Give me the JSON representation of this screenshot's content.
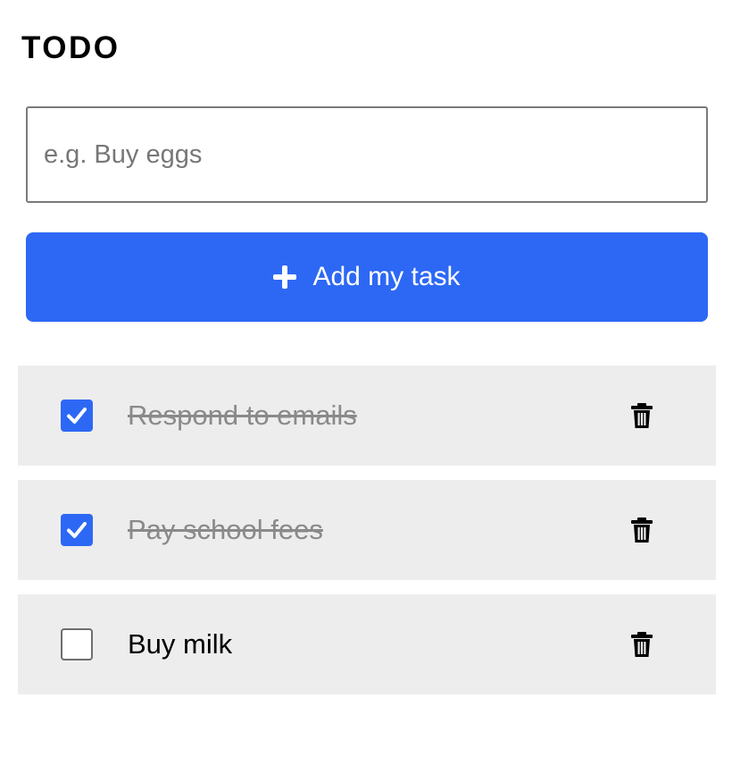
{
  "app": {
    "title": "TODO"
  },
  "new_task": {
    "placeholder": "e.g. Buy eggs",
    "value": "",
    "add_button_label": "Add my task",
    "add_button_icon": "plus-icon"
  },
  "tasks": [
    {
      "label": "Respond to emails",
      "completed": true
    },
    {
      "label": "Pay school fees",
      "completed": true
    },
    {
      "label": "Buy milk",
      "completed": false
    }
  ],
  "icons": {
    "delete": "trash-icon",
    "check": "checkmark-icon"
  },
  "colors": {
    "accent": "#2d68f5",
    "row_background": "#ededed",
    "completed_text": "#8a8a8a"
  }
}
